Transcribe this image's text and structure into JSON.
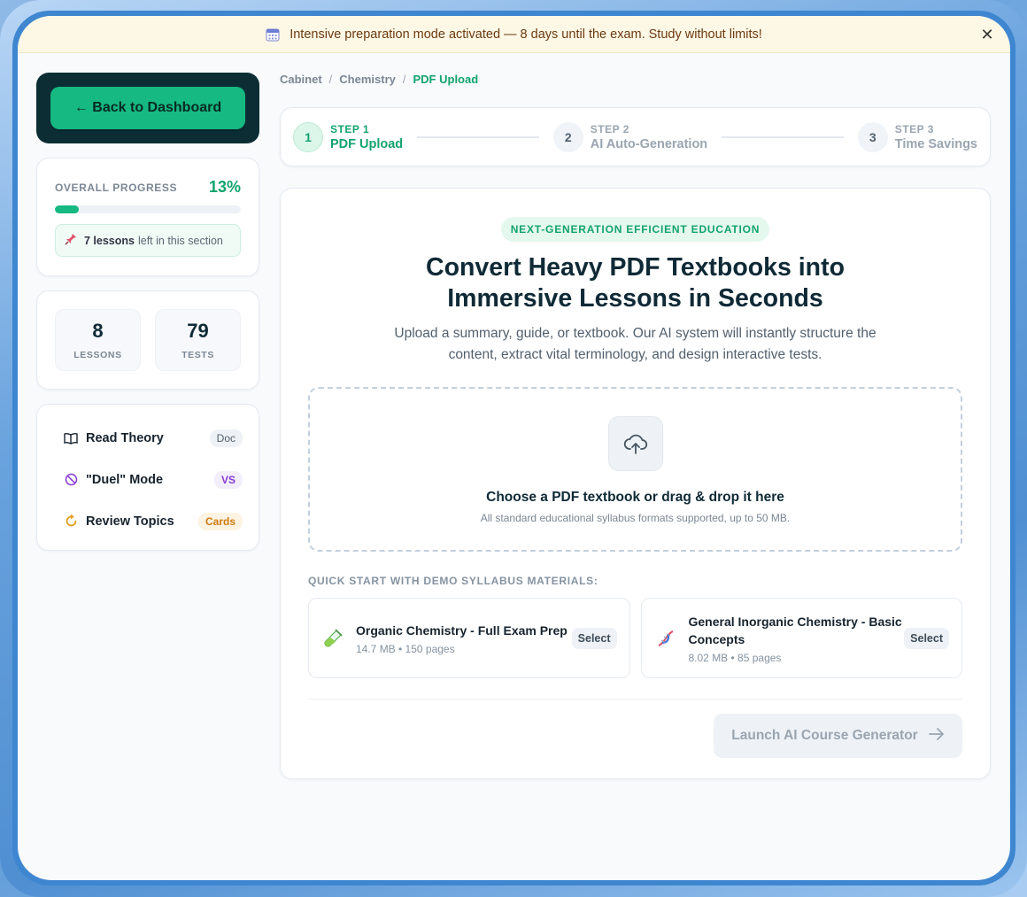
{
  "banner": {
    "text": "Intensive preparation mode activated — 8 days until the exam. Study without limits!",
    "close": "✕"
  },
  "sidebar": {
    "back_label": "← Back to Dashboard",
    "progress": {
      "label": "OVERALL PROGRESS",
      "value_text": "13%",
      "value": 13,
      "note_bold": "7 lessons",
      "note_rest": "left in this section"
    },
    "stats": [
      {
        "num": "8",
        "label": "LESSONS"
      },
      {
        "num": "79",
        "label": "TESTS"
      }
    ],
    "menu": [
      {
        "label": "Read Theory",
        "tag": "Doc",
        "icon": "book-icon"
      },
      {
        "label": "\"Duel\" Mode",
        "tag": "VS",
        "icon": "ban-icon"
      },
      {
        "label": "Review Topics",
        "tag": "Cards",
        "icon": "refresh-icon"
      }
    ]
  },
  "breadcrumb": [
    "Cabinet",
    "Chemistry",
    "PDF Upload"
  ],
  "steps": [
    {
      "num": "1",
      "kicker": "STEP 1",
      "name": "PDF Upload",
      "active": true
    },
    {
      "num": "2",
      "kicker": "STEP 2",
      "name": "AI Auto-Generation",
      "active": false
    },
    {
      "num": "3",
      "kicker": "STEP 3",
      "name": "Time Savings",
      "active": false
    }
  ],
  "hero": {
    "pill": "NEXT-GENERATION EFFICIENT EDUCATION",
    "title_line1": "Convert Heavy PDF Textbooks into",
    "title_line2": "Immersive Lessons in Seconds",
    "subtitle": "Upload a summary, guide, or textbook. Our AI system will instantly structure the content, extract vital terminology, and design interactive tests."
  },
  "upload": {
    "title": "Choose a PDF textbook or drag & drop it here",
    "hint": "All standard educational syllabus formats supported, up to 50 MB."
  },
  "quick": {
    "label": "QUICK START WITH DEMO SYLLABUS MATERIALS:",
    "items": [
      {
        "title": "Organic Chemistry - Full Exam Prep",
        "meta": "14.7 MB • 150 pages",
        "select": "Select",
        "icon": "test-tube-icon"
      },
      {
        "title": "General Inorganic Chemistry - Basic Concepts",
        "meta": "8.02 MB • 85 pages",
        "select": "Select",
        "icon": "dna-icon"
      }
    ]
  },
  "launch_label": "Launch AI Course Generator",
  "colors": {
    "accent": "#16b981",
    "accent_text": "#13a36e",
    "dark": "#0b2d33",
    "banner_bg": "#fdf8e6"
  }
}
